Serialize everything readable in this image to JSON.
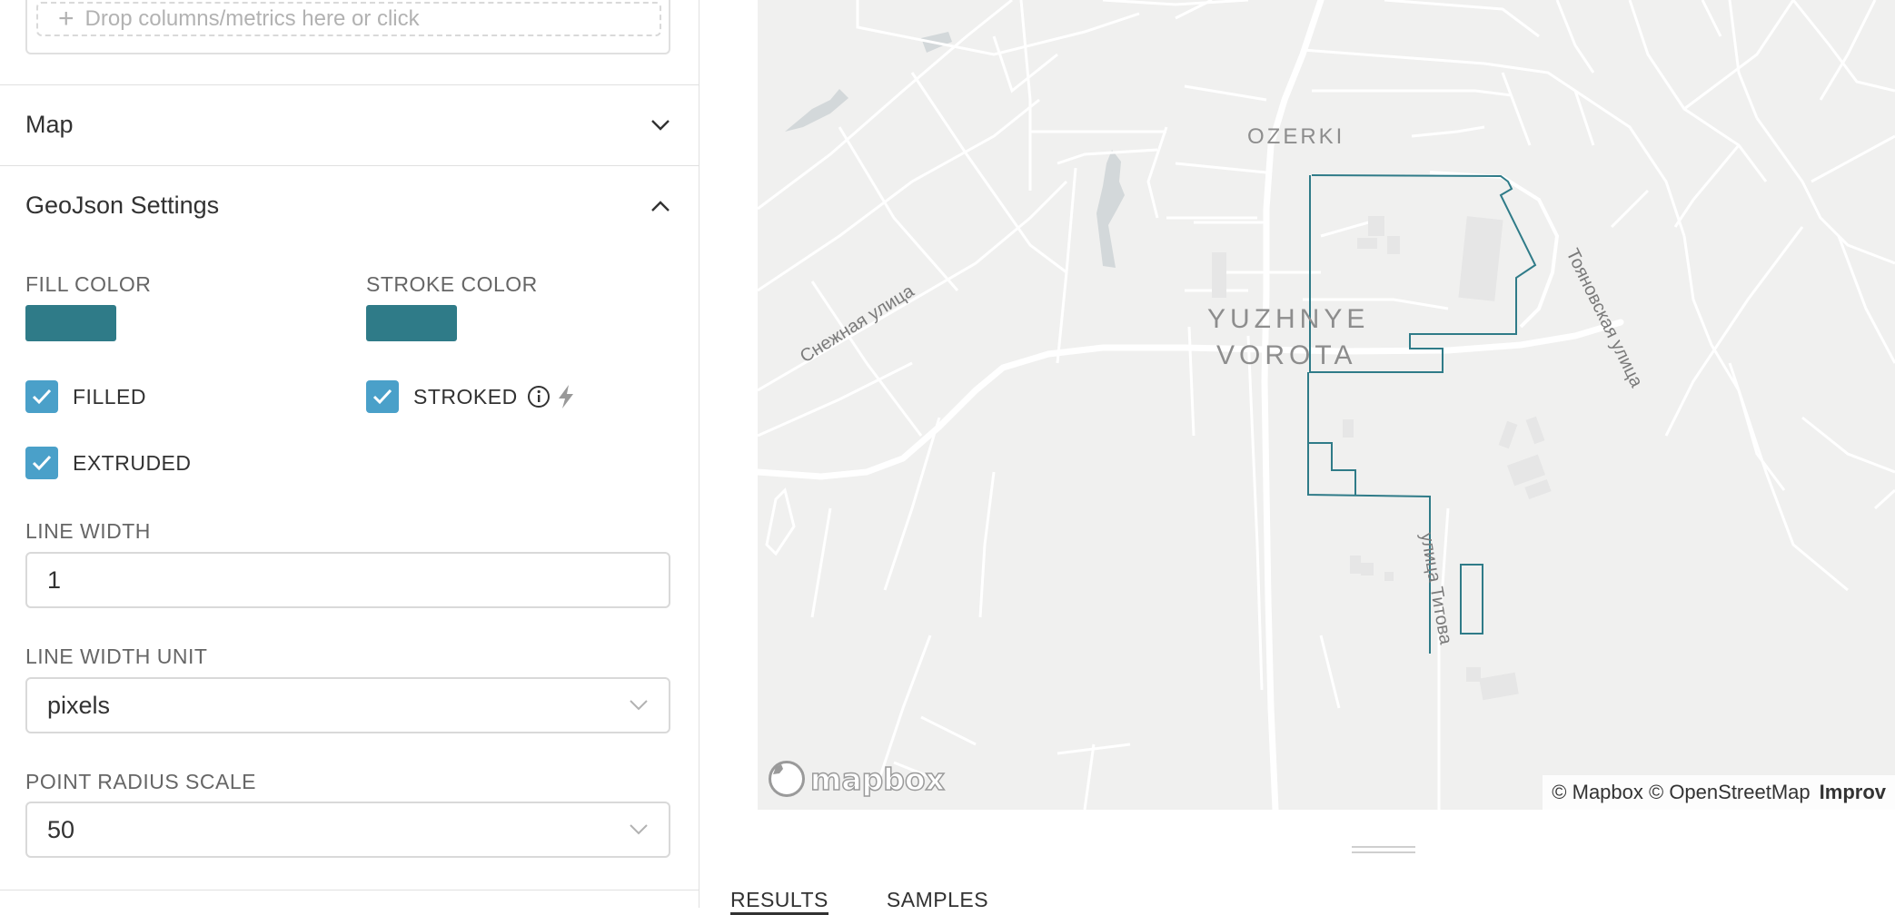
{
  "drop_zone": {
    "label": "Drop columns/metrics here or click",
    "icon": "plus-icon"
  },
  "sections": {
    "map": {
      "title": "Map",
      "icon": "chevron-down-icon"
    },
    "geojson": {
      "title": "GeoJson Settings",
      "icon": "chevron-up-icon"
    }
  },
  "fill_color": {
    "label": "FILL COLOR",
    "color": "#2f7b88"
  },
  "stroke_color": {
    "label": "STROKE COLOR",
    "color": "#2f7b88"
  },
  "checkboxes": {
    "filled": {
      "label": "FILLED",
      "checked": true
    },
    "stroked": {
      "label": "STROKED",
      "checked": true
    },
    "extruded": {
      "label": "EXTRUDED",
      "checked": true
    }
  },
  "line_width": {
    "label": "LINE WIDTH",
    "value": "1"
  },
  "line_width_unit": {
    "label": "LINE WIDTH UNIT",
    "value": "pixels"
  },
  "point_radius_scale": {
    "label": "POINT RADIUS SCALE",
    "value": "50"
  },
  "map": {
    "labels": {
      "ozerki": "OZERKI",
      "yuzhnye": "YUZHNYE",
      "vorota": "VOROTA",
      "snezhnaya": "Снежная улица",
      "toyanovskaya": "Тояновская улица",
      "titova": "улица Титова"
    },
    "logo": "mapbox",
    "attribution": "© Mapbox © OpenStreetMap",
    "improve": "Improv",
    "stroke_color": "#2f7b88"
  },
  "tabs": [
    {
      "label": "RESULTS",
      "active": true
    },
    {
      "label": "SAMPLES",
      "active": false
    }
  ],
  "accent": "#4aa0c9"
}
